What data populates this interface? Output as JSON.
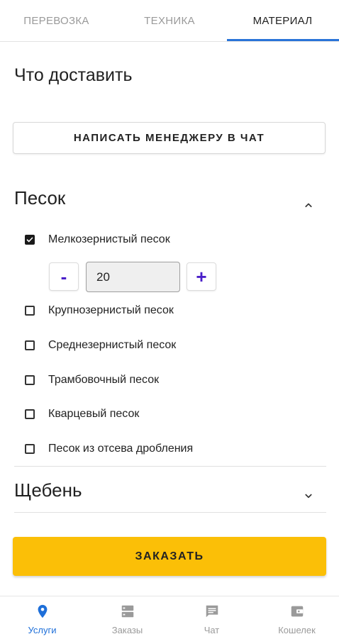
{
  "tabs": [
    {
      "label": "ПЕРЕВОЗКА"
    },
    {
      "label": "ТЕХНИКА"
    },
    {
      "label": "МАТЕРИАЛ",
      "active": true
    }
  ],
  "heading": "Что доставить",
  "chat_button_label": "НАПИСАТЬ МЕНЕДЖЕРУ В ЧАТ",
  "sections": [
    {
      "title": "Песок",
      "expanded": true,
      "items": [
        {
          "label": "Мелкозернистый песок",
          "checked": true
        },
        {
          "label": "Крупнозернистый песок",
          "checked": false
        },
        {
          "label": "Среднезернистый песок",
          "checked": false
        },
        {
          "label": "Трамбовочный песок",
          "checked": false
        },
        {
          "label": "Кварцевый песок",
          "checked": false
        },
        {
          "label": "Песок из отсева дробления",
          "checked": false
        }
      ]
    },
    {
      "title": "Щебень",
      "expanded": false
    }
  ],
  "stepper": {
    "minus": "-",
    "value": "20",
    "plus": "+"
  },
  "order_button_label": "ЗАКАЗАТЬ",
  "bottom_nav": [
    {
      "label": "Услуги",
      "icon": "location-pin-icon",
      "active": true
    },
    {
      "label": "Заказы",
      "icon": "orders-list-icon"
    },
    {
      "label": "Чат",
      "icon": "chat-icon"
    },
    {
      "label": "Кошелек",
      "icon": "wallet-icon"
    }
  ],
  "colors": {
    "accent": "#2a74d8",
    "order_button": "#fbbf07",
    "stepper_symbol": "#4a1fc9",
    "nav_active": "#1e6fd9"
  }
}
